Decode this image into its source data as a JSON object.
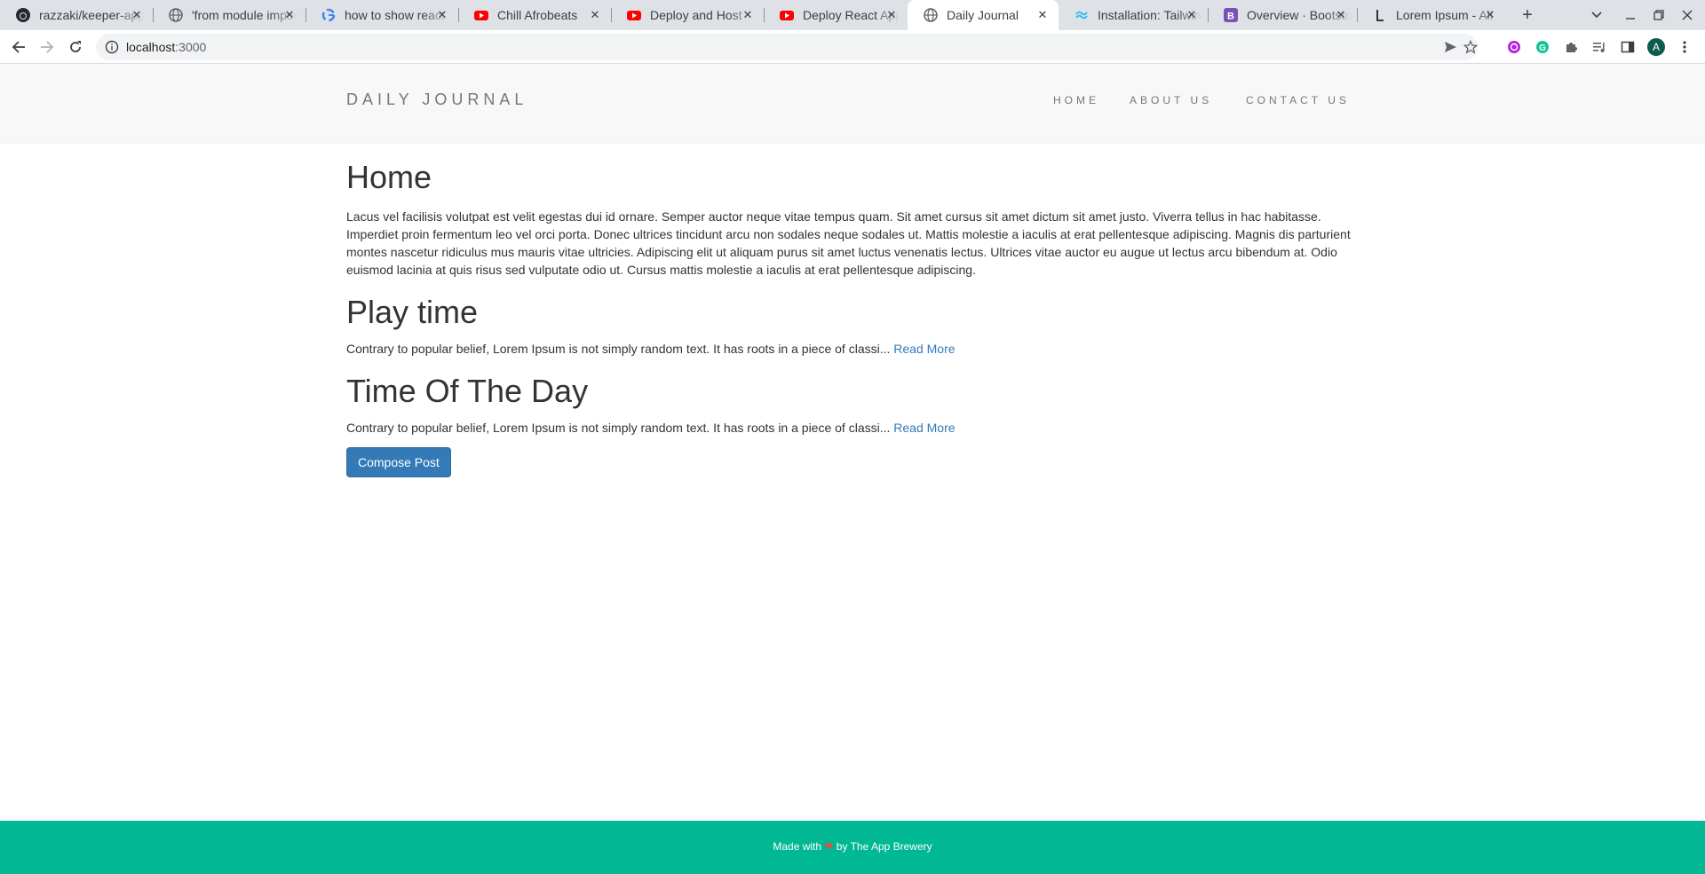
{
  "browser": {
    "tabs": [
      {
        "title": "razzaki/keeper-app",
        "icon": "github-icon"
      },
      {
        "title": "'from module import'",
        "icon": "globe-icon"
      },
      {
        "title": "how to show react",
        "icon": "google-icon"
      },
      {
        "title": "Chill Afrobeats",
        "icon": "youtube-icon"
      },
      {
        "title": "Deploy and Host",
        "icon": "youtube-icon"
      },
      {
        "title": "Deploy React App",
        "icon": "youtube-icon"
      },
      {
        "title": "Daily Journal",
        "icon": "globe-icon",
        "active": true
      },
      {
        "title": "Installation: Tailwind",
        "icon": "tailwind-icon"
      },
      {
        "title": "Overview · Bootstrap",
        "icon": "bootstrap-icon"
      },
      {
        "title": "Lorem Ipsum - All",
        "icon": "lipsum-icon"
      }
    ],
    "new_tab_label": "+",
    "url_host": "localhost",
    "url_port": ":3000",
    "profile_initial": "A"
  },
  "site": {
    "brand": "DAILY JOURNAL",
    "nav": {
      "home": "HOME",
      "about": "ABOUT US",
      "contact": "CONTACT US"
    }
  },
  "main": {
    "heading": "Home",
    "intro": "Lacus vel facilisis volutpat est velit egestas dui id ornare. Semper auctor neque vitae tempus quam. Sit amet cursus sit amet dictum sit amet justo. Viverra tellus in hac habitasse. Imperdiet proin fermentum leo vel orci porta. Donec ultrices tincidunt arcu non sodales neque sodales ut. Mattis molestie a iaculis at erat pellentesque adipiscing. Magnis dis parturient montes nascetur ridiculus mus mauris vitae ultricies. Adipiscing elit ut aliquam purus sit amet luctus venenatis lectus. Ultrices vitae auctor eu augue ut lectus arcu bibendum at. Odio euismod lacinia at quis risus sed vulputate odio ut. Cursus mattis molestie a iaculis at erat pellentesque adipiscing.",
    "posts": [
      {
        "title": "Play time",
        "excerpt": "Contrary to popular belief, Lorem Ipsum is not simply random text. It has roots in a piece of classi...",
        "link": "Read More"
      },
      {
        "title": "Time Of The Day",
        "excerpt": "Contrary to popular belief, Lorem Ipsum is not simply random text. It has roots in a piece of classi...",
        "link": "Read More"
      }
    ],
    "compose_label": "Compose Post"
  },
  "footer": {
    "before": "Made with",
    "heart": "❤",
    "after": "by The App Brewery"
  },
  "colors": {
    "footer_bg": "#00b894",
    "link": "#337ab7",
    "button": "#337ab7"
  }
}
